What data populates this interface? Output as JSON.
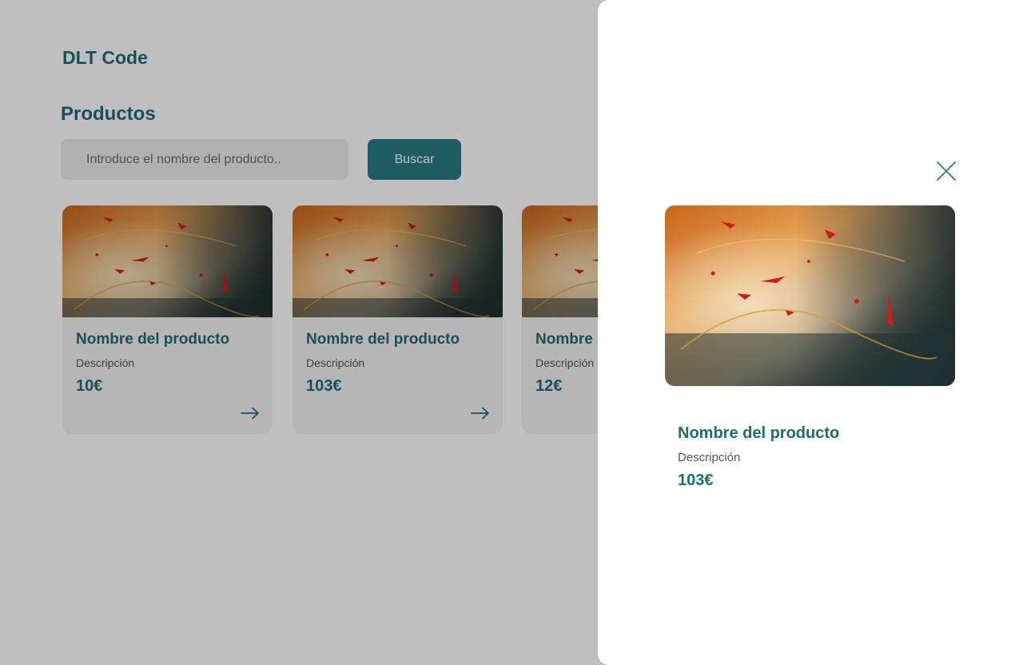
{
  "header": {
    "brand": "DLT Code"
  },
  "section": {
    "title": "Productos"
  },
  "search": {
    "placeholder": "Introduce el nombre del producto..",
    "button_label": "Buscar"
  },
  "products": [
    {
      "name": "Nombre del producto",
      "description": "Descripción",
      "price": "10€",
      "icon": "arrow-right-icon"
    },
    {
      "name": "Nombre del producto",
      "description": "Descripción",
      "price": "103€",
      "icon": "arrow-right-icon"
    },
    {
      "name": "Nombre del producto",
      "description": "Descripción",
      "price": "12€",
      "icon": "arrow-right-icon"
    }
  ],
  "drawer": {
    "close_icon": "close-icon",
    "product": {
      "name": "Nombre del producto",
      "description": "Descripción",
      "price": "103€"
    }
  },
  "colors": {
    "accent": "#1f6b76",
    "button": "#2a7b86",
    "overlay": "rgba(0,0,0,0.25)"
  }
}
